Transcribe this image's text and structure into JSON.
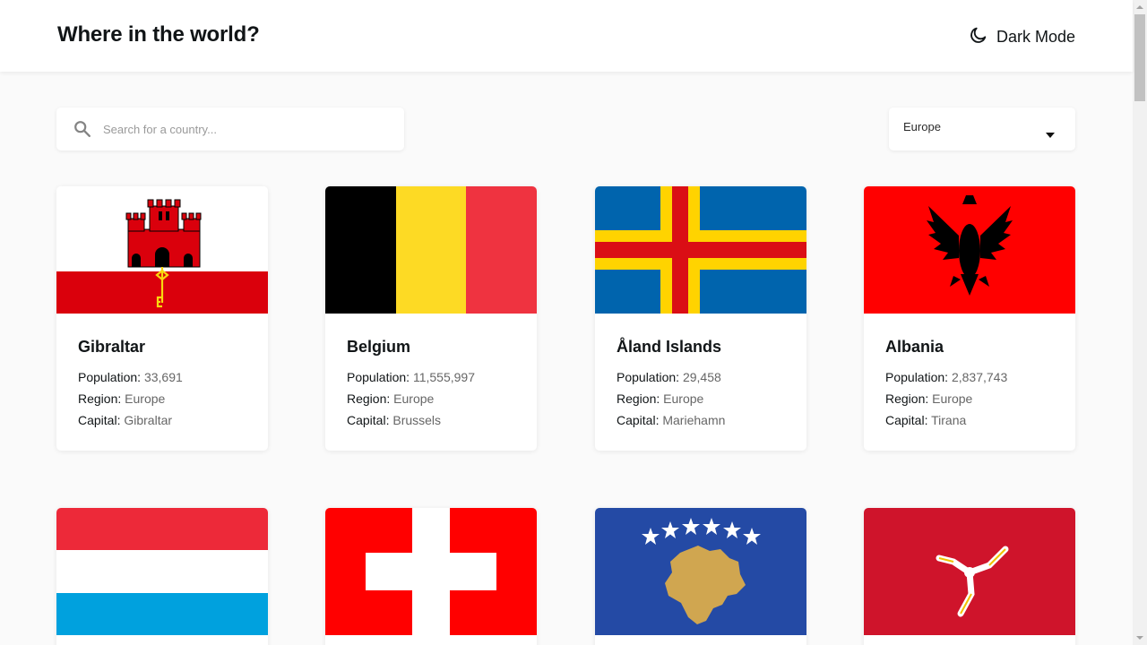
{
  "header": {
    "title": "Where in the world?",
    "dark_mode_label": "Dark Mode",
    "dark_mode_icon": "moon-icon"
  },
  "search": {
    "placeholder": "Search for a country...",
    "value": "",
    "icon": "search-icon"
  },
  "filter": {
    "selected": "Europe",
    "icon": "caret-down-icon"
  },
  "labels": {
    "population": "Population:",
    "region": "Region:",
    "capital": "Capital:"
  },
  "countries": [
    {
      "name": "Gibraltar",
      "population": "33,691",
      "region": "Europe",
      "capital": "Gibraltar",
      "flag": "gibraltar-flag"
    },
    {
      "name": "Belgium",
      "population": "11,555,997",
      "region": "Europe",
      "capital": "Brussels",
      "flag": "belgium-flag"
    },
    {
      "name": "Åland Islands",
      "population": "29,458",
      "region": "Europe",
      "capital": "Mariehamn",
      "flag": "aland-islands-flag"
    },
    {
      "name": "Albania",
      "population": "2,837,743",
      "region": "Europe",
      "capital": "Tirana",
      "flag": "albania-flag"
    },
    {
      "flag": "luxembourg-flag"
    },
    {
      "flag": "switzerland-flag"
    },
    {
      "flag": "kosovo-flag"
    },
    {
      "flag": "isle-of-man-flag"
    }
  ],
  "colors": {
    "background": "#fafafa",
    "card": "#ffffff",
    "text": "#111517",
    "muted": "#666666"
  }
}
